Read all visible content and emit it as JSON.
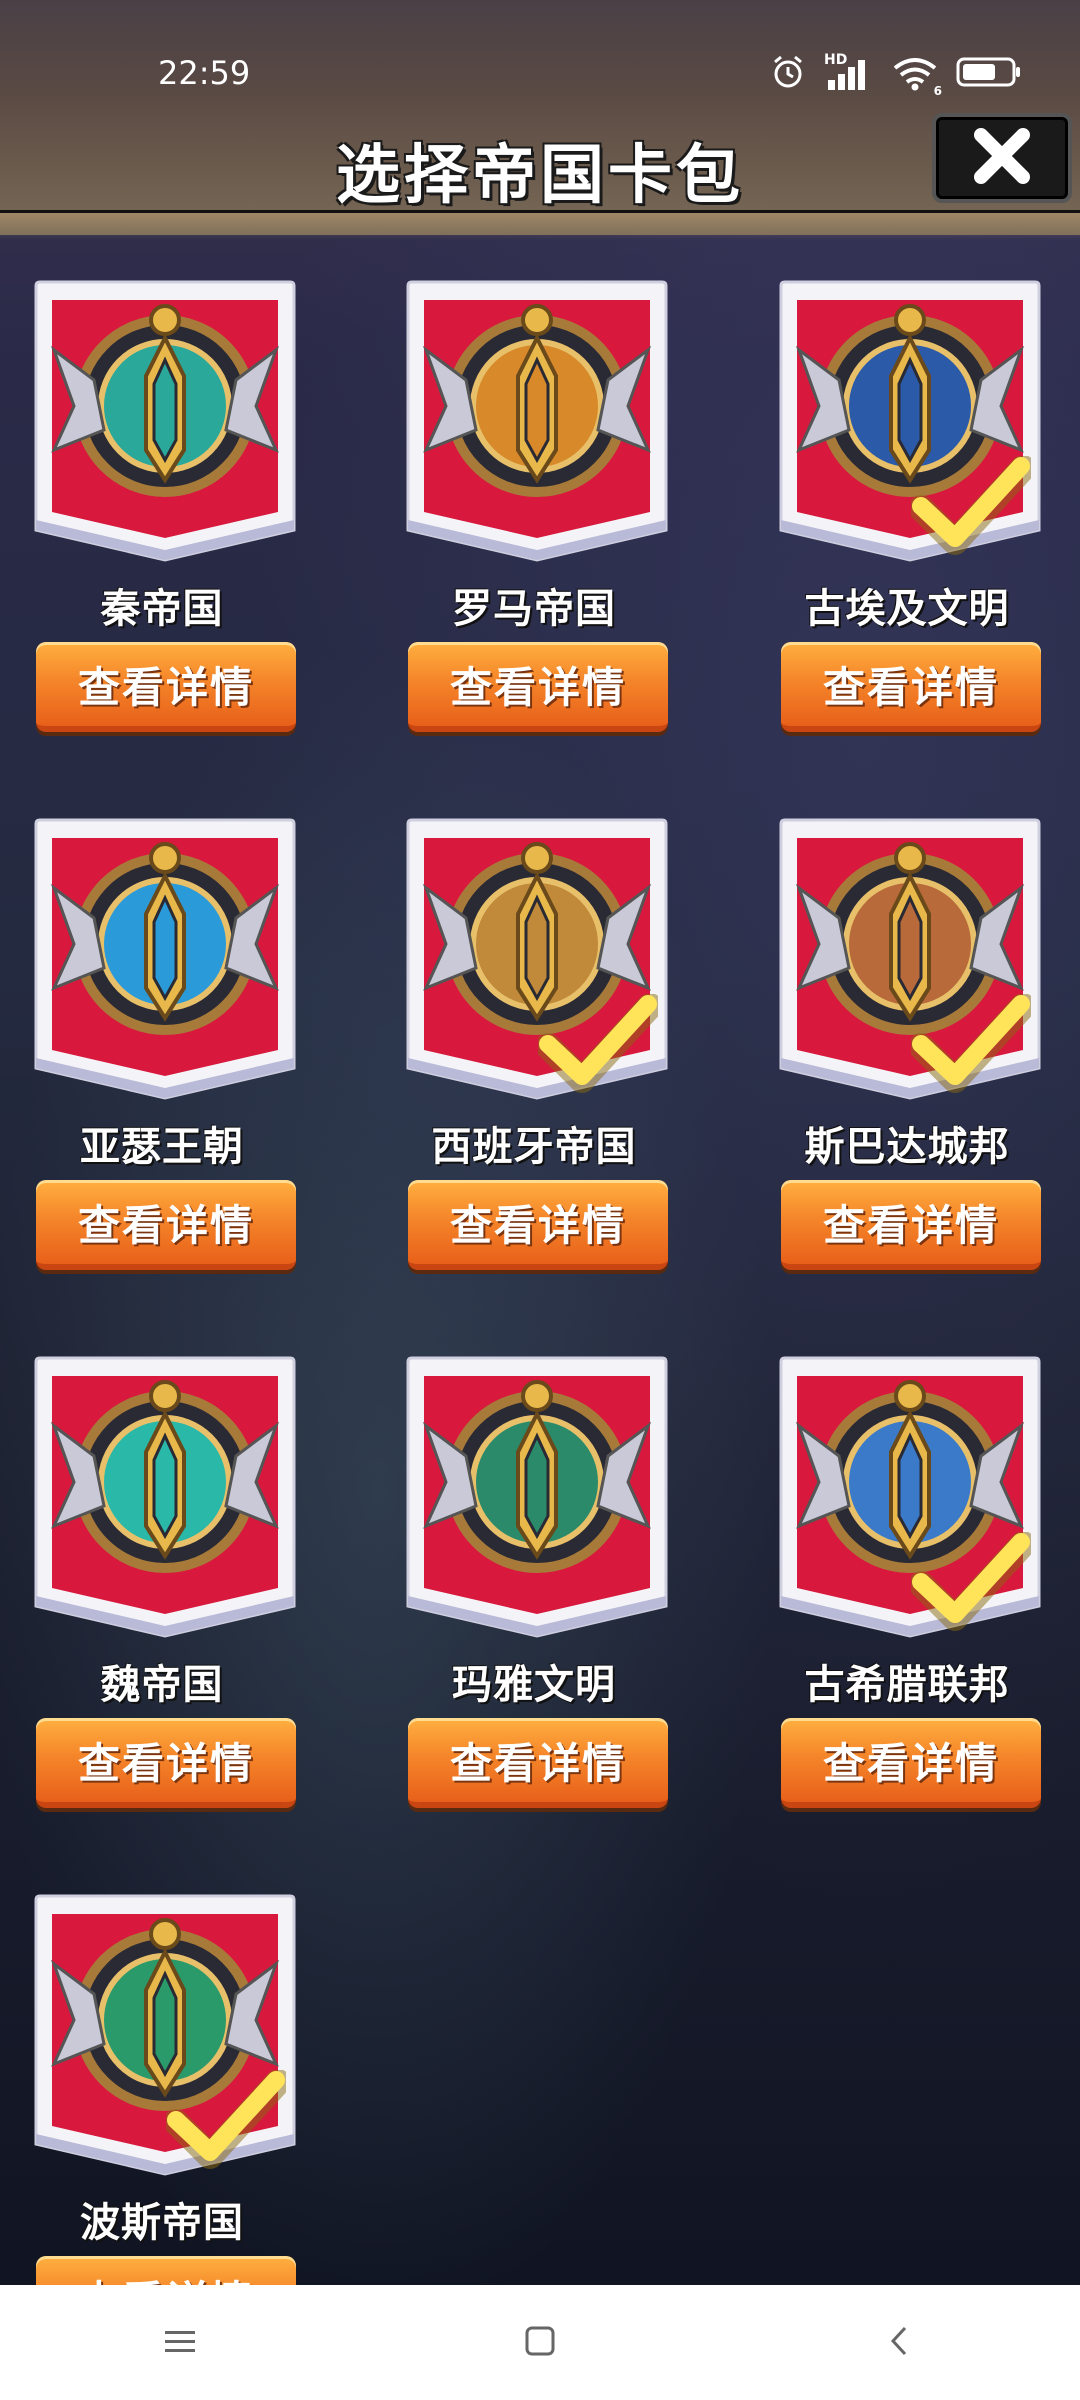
{
  "status_bar": {
    "time": "22:59",
    "network_label": "HD",
    "wifi_sub": "6"
  },
  "header": {
    "title": "选择帝国卡包",
    "close_icon": "close-icon"
  },
  "cards": [
    {
      "name": "秦帝国",
      "button": "查看详情",
      "selected": false,
      "emblem": "qin-emblem-icon",
      "accent": "#2aa89a"
    },
    {
      "name": "罗马帝国",
      "button": "查看详情",
      "selected": false,
      "emblem": "rome-emblem-icon",
      "accent": "#d88a2a"
    },
    {
      "name": "古埃及文明",
      "button": "查看详情",
      "selected": true,
      "emblem": "egypt-emblem-icon",
      "accent": "#2a5aa8"
    },
    {
      "name": "亚瑟王朝",
      "button": "查看详情",
      "selected": false,
      "emblem": "arthur-emblem-icon",
      "accent": "#2a9ad8"
    },
    {
      "name": "西班牙帝国",
      "button": "查看详情",
      "selected": true,
      "emblem": "spain-emblem-icon",
      "accent": "#c08a3a"
    },
    {
      "name": "斯巴达城邦",
      "button": "查看详情",
      "selected": true,
      "emblem": "sparta-emblem-icon",
      "accent": "#b86a3a"
    },
    {
      "name": "魏帝国",
      "button": "查看详情",
      "selected": false,
      "emblem": "wei-emblem-icon",
      "accent": "#2ab8a8"
    },
    {
      "name": "玛雅文明",
      "button": "查看详情",
      "selected": false,
      "emblem": "maya-emblem-icon",
      "accent": "#2a8a6a"
    },
    {
      "name": "古希腊联邦",
      "button": "查看详情",
      "selected": true,
      "emblem": "greece-emblem-icon",
      "accent": "#3a7ac8"
    },
    {
      "name": "波斯帝国",
      "button": "查看详情",
      "selected": true,
      "emblem": "persia-emblem-icon",
      "accent": "#2a9a6a"
    }
  ],
  "colors": {
    "card_bg": "#d8183c",
    "button_orange": "#f5862a",
    "check_yellow": "#ffe45a"
  },
  "nav": {
    "menu_icon": "menu-icon",
    "home_icon": "home-icon",
    "back_icon": "back-icon"
  }
}
